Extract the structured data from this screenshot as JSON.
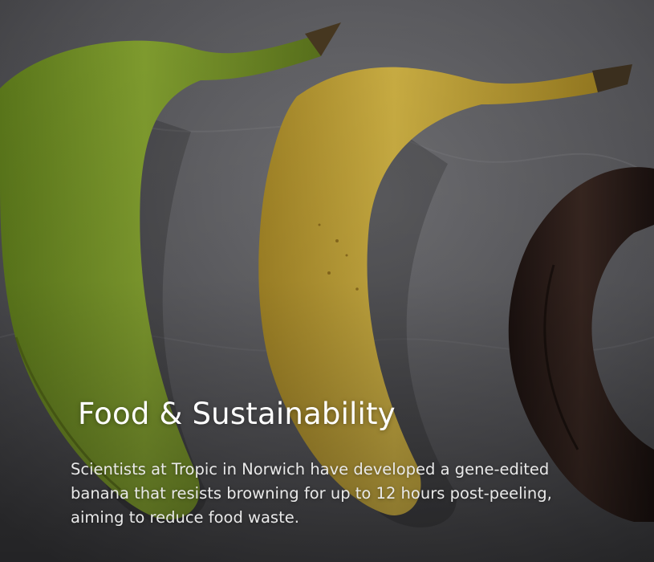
{
  "article": {
    "title": "Food & Sustainability",
    "summary": "Scientists at Tropic in Norwich have developed a gene-edited banana that resists browning for up to 12 hours post-peeling, aiming to reduce food waste."
  },
  "photo": {
    "subject": [
      {
        "icon": "green-banana-icon",
        "color": "#7c9a2a"
      },
      {
        "icon": "yellow-banana-icon",
        "color": "#c7a73a"
      },
      {
        "icon": "brown-banana-icon",
        "color": "#2b1d19"
      }
    ]
  },
  "colors": {
    "background": "#4e4e52",
    "text": "#ffffff"
  }
}
